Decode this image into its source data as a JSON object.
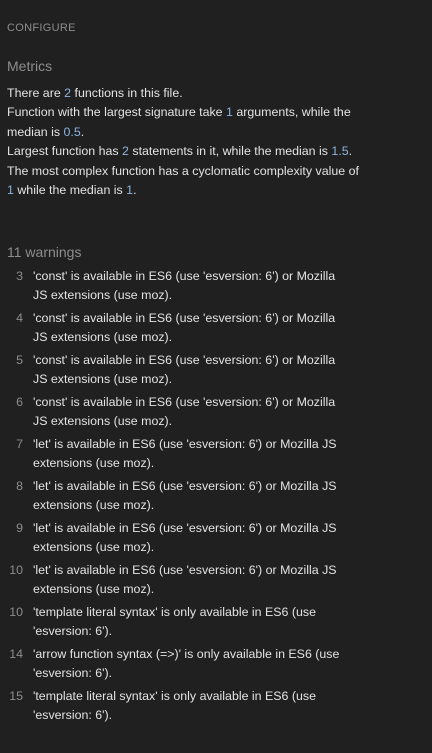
{
  "panel": {
    "configure_label": "CONFIGURE"
  },
  "metrics": {
    "title": "Metrics",
    "line1": {
      "pre": "There are ",
      "num": "2",
      "post": " functions in this file."
    },
    "line2": {
      "pre": "Function with the largest signature take ",
      "num1": "1",
      "mid": " arguments, while the median is ",
      "num2": "0.5",
      "post": "."
    },
    "line3": {
      "pre": "Largest function has ",
      "num1": "2",
      "mid": " statements in it, while the median is ",
      "num2": "1.5",
      "post": "."
    },
    "line4": {
      "pre": "The most complex function has a cyclomatic complexity value of ",
      "num1": "1",
      "mid": " while the median is ",
      "num2": "1",
      "post": "."
    }
  },
  "warnings": {
    "title": "11 warnings",
    "items": [
      {
        "line": "3",
        "text": "'const' is available in ES6 (use 'esversion: 6') or Mozilla JS extensions (use moz)."
      },
      {
        "line": "4",
        "text": "'const' is available in ES6 (use 'esversion: 6') or Mozilla JS extensions (use moz)."
      },
      {
        "line": "5",
        "text": "'const' is available in ES6 (use 'esversion: 6') or Mozilla JS extensions (use moz)."
      },
      {
        "line": "6",
        "text": "'const' is available in ES6 (use 'esversion: 6') or Mozilla JS extensions (use moz)."
      },
      {
        "line": "7",
        "text": "'let' is available in ES6 (use 'esversion: 6') or Mozilla JS extensions (use moz)."
      },
      {
        "line": "8",
        "text": "'let' is available in ES6 (use 'esversion: 6') or Mozilla JS extensions (use moz)."
      },
      {
        "line": "9",
        "text": "'let' is available in ES6 (use 'esversion: 6') or Mozilla JS extensions (use moz)."
      },
      {
        "line": "10",
        "text": "'let' is available in ES6 (use 'esversion: 6') or Mozilla JS extensions (use moz)."
      },
      {
        "line": "10",
        "text": "'template literal syntax' is only available in ES6 (use 'esversion: 6')."
      },
      {
        "line": "14",
        "text": "'arrow function syntax (=>)' is only available in ES6 (use 'esversion: 6')."
      },
      {
        "line": "15",
        "text": "'template literal syntax' is only available in ES6 (use 'esversion: 6')."
      }
    ]
  },
  "colors": {
    "background": "#202020",
    "text": "#e3e3e3",
    "muted": "#8d8d8d",
    "number_accent": "#8bb4e0"
  }
}
